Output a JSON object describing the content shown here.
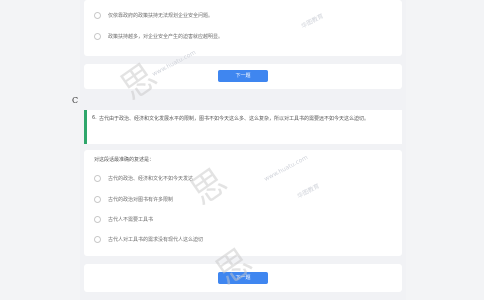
{
  "top_card": {
    "options": [
      "仅依靠政府的政策扶持无法规划企业安全问题。",
      "政策扶持越多，对企业安全产生的迫害就应越明显。"
    ],
    "next_label": "下一题"
  },
  "section_letter": "C",
  "question": {
    "number": "6.",
    "text": "古代由于政治、经济和文化发展水平的限制，图书不如今天这么多、这么复杂，所以对工具书的需要远不如今天这么迫切。"
  },
  "answer_card": {
    "prompt": "对这段话最准确的复述是：",
    "options": [
      "古代的政治、经济和文化不如今天发达",
      "古代的政治对图书有许多限制",
      "古代人不需要工具书",
      "古代人对工具书的需求没有现代人这么迫切"
    ],
    "next_label": "下一题"
  },
  "watermarks": {
    "small": [
      "华图教育",
      "华图教育",
      "www.huatu.com",
      "www.huatu.com"
    ],
    "large": [
      "思",
      "思",
      "思"
    ]
  },
  "colors": {
    "accent_blue": "#3f86f0",
    "question_bar_green": "#2ea66b"
  }
}
